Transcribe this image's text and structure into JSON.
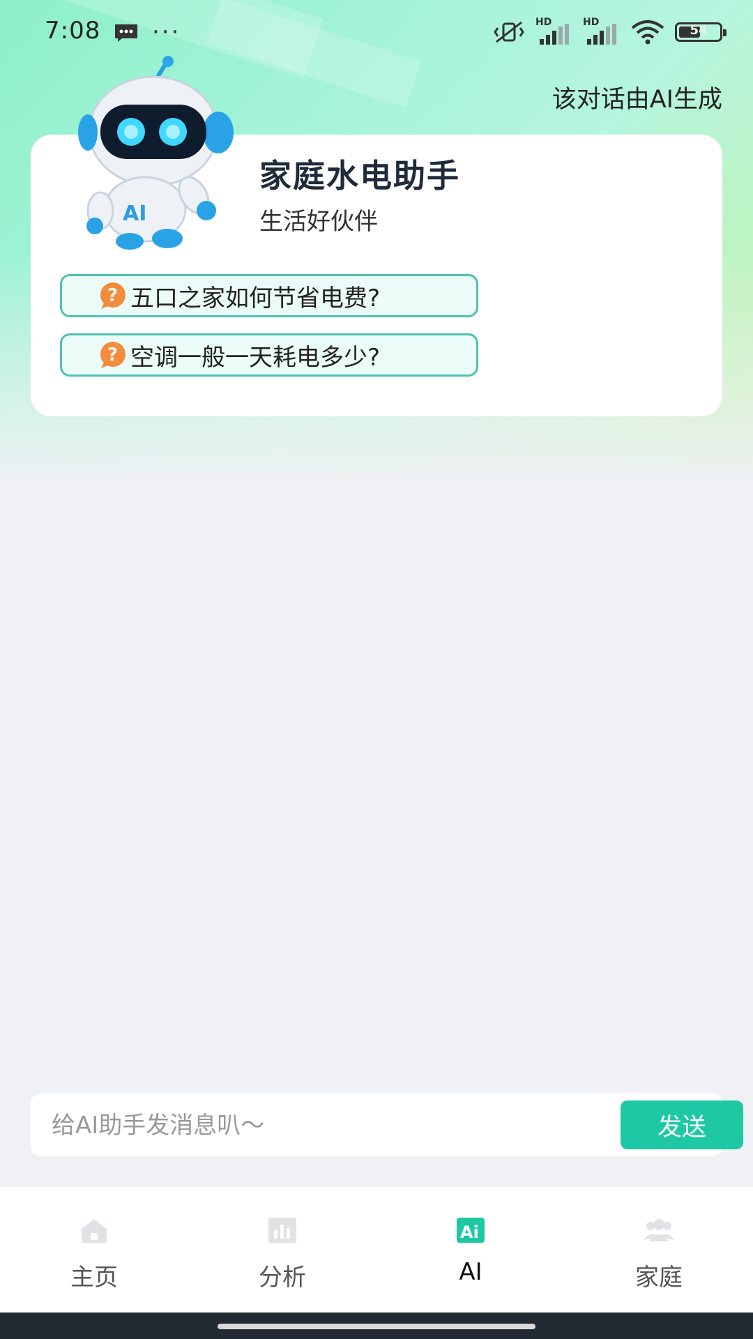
{
  "status_bar": {
    "time": "7:08",
    "more": "···",
    "battery": "54",
    "hd_label": "HD"
  },
  "header": {
    "ai_notice": "该对话由AI生成",
    "robot_chest_label": "AI",
    "title": "家庭水电助手",
    "subtitle": "生活好伙伴"
  },
  "suggestions": [
    {
      "label": "五口之家如何节省电费?"
    },
    {
      "label": "空调一般一天耗电多少?"
    }
  ],
  "input": {
    "placeholder": "给AI助手发消息叭～",
    "send_label": "发送"
  },
  "nav": {
    "items": [
      {
        "label": "主页",
        "icon": "home-icon"
      },
      {
        "label": "分析",
        "icon": "chart-icon"
      },
      {
        "label": "AI",
        "icon": "ai-icon",
        "icon_text": "Ai",
        "active": true
      },
      {
        "label": "家庭",
        "icon": "family-icon"
      }
    ]
  },
  "colors": {
    "accent": "#1fc8a4",
    "suggestion_border": "#4ec2b1",
    "suggestion_bg": "#ebfbf7",
    "page_bg": "#eff1f4"
  }
}
